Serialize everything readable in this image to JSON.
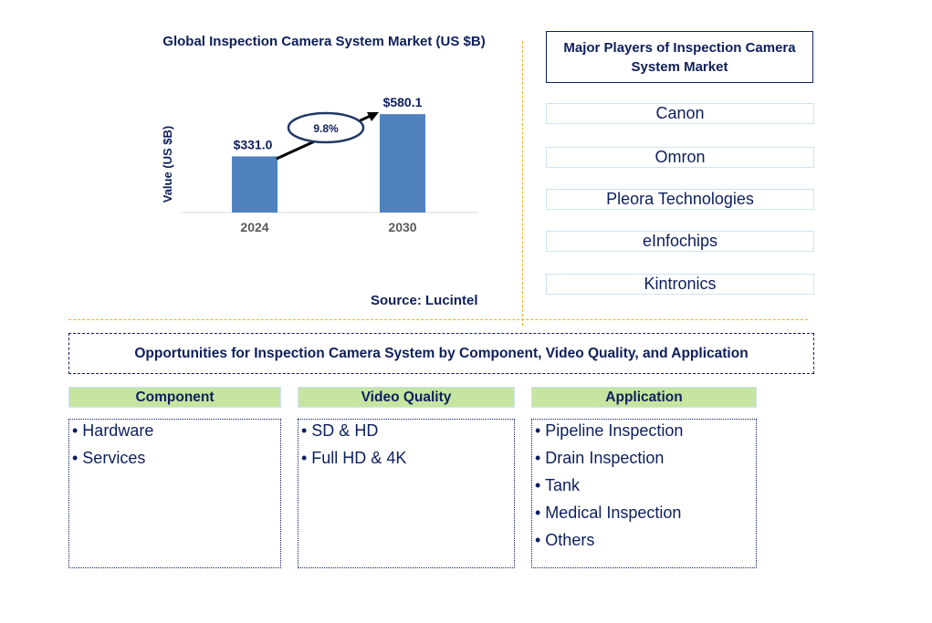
{
  "chart_data": {
    "type": "bar",
    "title": "Global Inspection Camera System Market (US $B)",
    "categories": [
      "2024",
      "2030"
    ],
    "values": [
      331.0,
      580.1
    ],
    "value_labels": [
      "$331.0",
      "$580.1"
    ],
    "xlabel": "",
    "ylabel": "Value (US $B)",
    "ylim": [
      0,
      650
    ],
    "grid": false,
    "bar_color": "#4f81bd",
    "annotation": {
      "text": "9.8%",
      "meaning": "CAGR 2024-2030"
    },
    "source": "Source: Lucintel"
  },
  "players": {
    "title": "Major Players of Inspection Camera System Market",
    "items": [
      "Canon",
      "Omron",
      "Pleora Technologies",
      "eInfochips",
      "Kintronics"
    ]
  },
  "opportunities": {
    "title": "Opportunities for Inspection Camera System by Component, Video Quality, and Application",
    "categories": [
      {
        "name": "Component",
        "items": [
          "• Hardware",
          "• Services"
        ]
      },
      {
        "name": "Video Quality",
        "items": [
          "• SD & HD",
          "• Full HD & 4K"
        ]
      },
      {
        "name": "Application",
        "items": [
          "• Pipeline Inspection",
          "• Drain Inspection",
          "• Tank",
          "• Medical Inspection",
          "• Others"
        ]
      }
    ]
  },
  "colors": {
    "navy": "#0d1f5c",
    "bar": "#4f81bd",
    "header_green": "#c6e5a0",
    "divider": "#f5b21c"
  }
}
